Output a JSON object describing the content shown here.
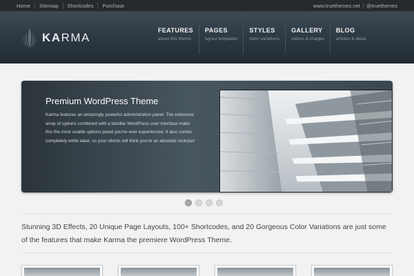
{
  "topbar": {
    "links": [
      "Home",
      "Sitemap",
      "Shortcodes",
      "Purchase"
    ],
    "right_links": [
      "www.truethemes.net",
      "@truethemes"
    ]
  },
  "logo": {
    "bold": "KA",
    "rest": "RMA"
  },
  "nav": [
    {
      "label": "FEATURES",
      "sub": "about this theme"
    },
    {
      "label": "PAGES",
      "sub": "layout templates"
    },
    {
      "label": "STYLES",
      "sub": "color variations"
    },
    {
      "label": "GALLERY",
      "sub": "videos & images"
    },
    {
      "label": "BLOG",
      "sub": "articles & ideas"
    }
  ],
  "slider": {
    "title": "Premium WordPress Theme",
    "text": "Karma features an amazingly powerful administration panel. The extensive array of options combined with a familiar WordPress user interface make this the most usable options panel you've ever experienced. It also comes completely white label, so your clients will think you're an absolute rockstar!",
    "pages": 4,
    "active_page": 1
  },
  "tagline": "Stunning 3D Effects, 20 Unique Page Layouts, 100+ Shortcodes, and 20 Gorgeous Color Variations are just some of the features that make Karma the premiere WordPress Theme.",
  "colors": {
    "header": "#2c3740",
    "accent": "#f2f4f5",
    "background": "#f2f2f2"
  }
}
